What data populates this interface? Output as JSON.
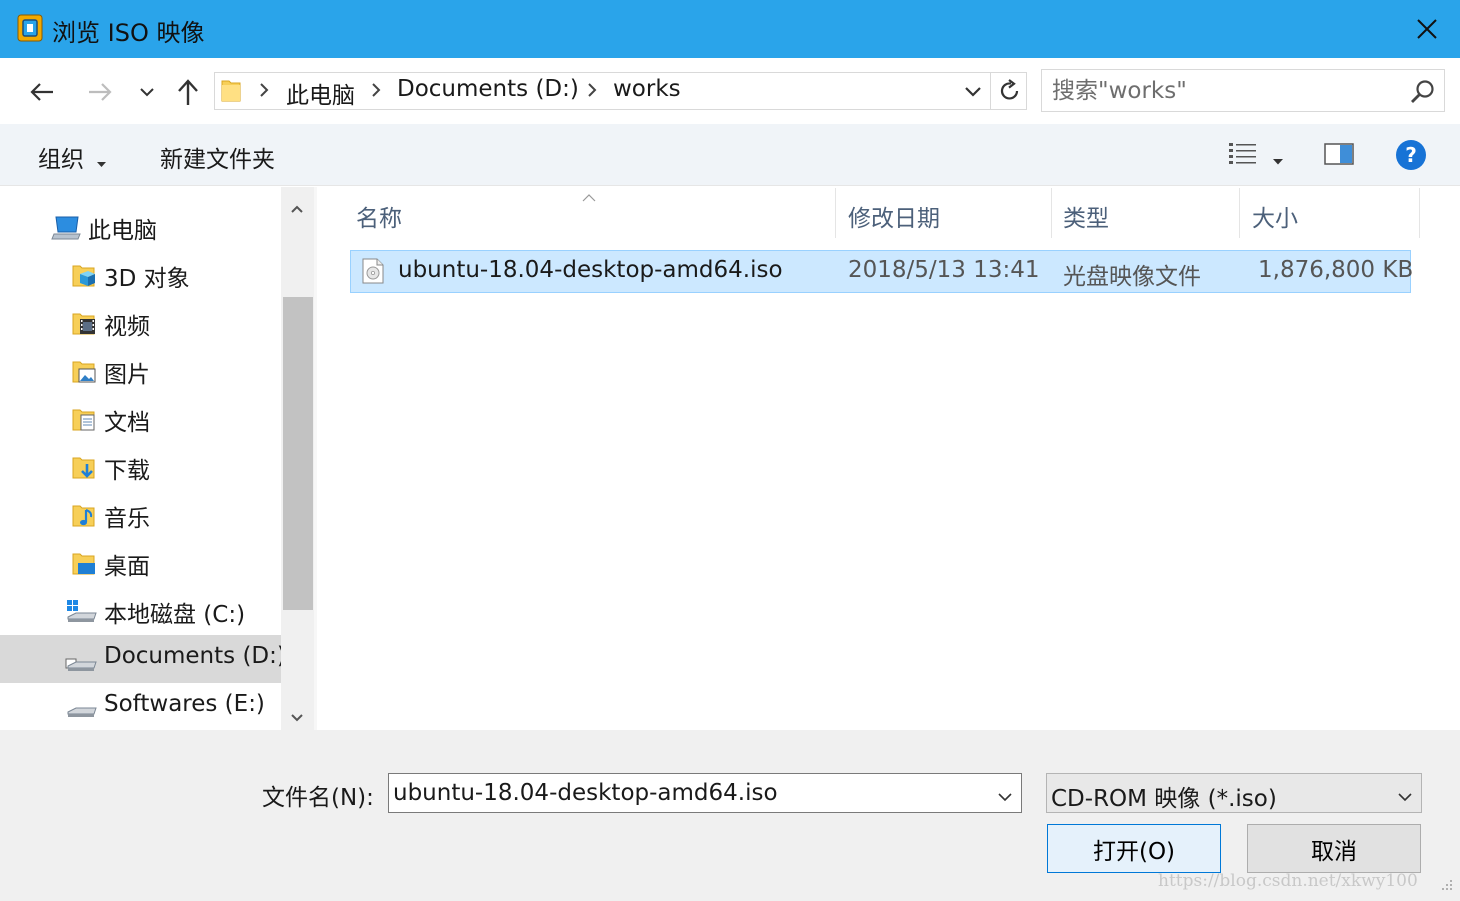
{
  "window": {
    "title": "浏览 ISO 映像",
    "colors": {
      "titlebar": "#2aa4ea",
      "selection": "#cce8ff",
      "accent": "#0078d7"
    }
  },
  "nav": {
    "breadcrumb": [
      "此电脑",
      "Documents (D:)",
      "works"
    ],
    "search_placeholder": "搜索\"works\""
  },
  "toolbar": {
    "organize_label": "组织",
    "new_folder_label": "新建文件夹"
  },
  "sidebar": {
    "root_label": "此电脑",
    "items": [
      {
        "label": "3D 对象",
        "icon": "3d-objects-icon"
      },
      {
        "label": "视频",
        "icon": "video-folder-icon"
      },
      {
        "label": "图片",
        "icon": "pictures-folder-icon"
      },
      {
        "label": "文档",
        "icon": "documents-folder-icon"
      },
      {
        "label": "下载",
        "icon": "downloads-folder-icon"
      },
      {
        "label": "音乐",
        "icon": "music-folder-icon"
      },
      {
        "label": "桌面",
        "icon": "desktop-folder-icon"
      },
      {
        "label": "本地磁盘 (C:)",
        "icon": "system-drive-icon"
      },
      {
        "label": "Documents (D:)",
        "icon": "drive-icon",
        "selected": true
      },
      {
        "label": "Softwares (E:)",
        "icon": "drive-icon"
      }
    ]
  },
  "file_list": {
    "columns": [
      "名称",
      "修改日期",
      "类型",
      "大小"
    ],
    "rows": [
      {
        "name": "ubuntu-18.04-desktop-amd64.iso",
        "modified": "2018/5/13 13:41",
        "type": "光盘映像文件",
        "size": "1,876,800 KB",
        "selected": true
      }
    ]
  },
  "footer": {
    "filename_label": "文件名(N):",
    "filename_value": "ubuntu-18.04-desktop-amd64.iso",
    "filetype_value": "CD-ROM 映像 (*.iso)",
    "open_label": "打开(O)",
    "cancel_label": "取消"
  },
  "watermark": "https://blog.csdn.net/xkwy100"
}
